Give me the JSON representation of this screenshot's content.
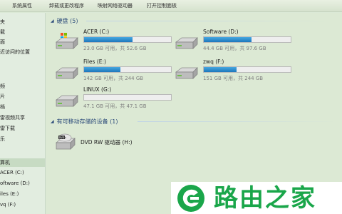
{
  "toolbar": {
    "items": [
      "系统属性",
      "卸载或更改程序",
      "映射网络驱动器",
      "打开控制面板"
    ]
  },
  "sidebar": {
    "items": [
      {
        "label": "夹"
      },
      {
        "label": "载"
      },
      {
        "label": "面"
      },
      {
        "label": "近访问的位置"
      },
      {
        "label": "频"
      },
      {
        "label": "片"
      },
      {
        "label": "档"
      },
      {
        "label": "雷视频共享"
      },
      {
        "label": "雷下载"
      },
      {
        "label": "乐"
      },
      {
        "label": "算机"
      },
      {
        "label": "ACER (C:)"
      },
      {
        "label": "oftware (D:)"
      },
      {
        "label": "iles (E:)"
      },
      {
        "label": "vq (F:)"
      }
    ],
    "selected_index": 10
  },
  "hard_disks": {
    "header": "硬盘 (5)",
    "drives": [
      {
        "name": "ACER (C:)",
        "space": "23.0 GB 可用，共 52.6 GB",
        "used_fraction": 0.56,
        "icon": "windows-drive-icon"
      },
      {
        "name": "Software (D:)",
        "space": "44.4 GB 可用，共 97.6 GB",
        "used_fraction": 0.55,
        "icon": "hard-drive-icon"
      },
      {
        "name": "Files (E:)",
        "space": "142 GB 可用，共 244 GB",
        "used_fraction": 0.42,
        "icon": "hard-drive-icon"
      },
      {
        "name": "zwq (F:)",
        "space": "151 GB 可用，共 244 GB",
        "used_fraction": 0.38,
        "icon": "hard-drive-icon"
      },
      {
        "name": "LINUX (G:)",
        "space": "47.1 GB 可用，共 47.1 GB",
        "used_fraction": 0.0,
        "icon": "hard-drive-icon"
      }
    ]
  },
  "removable": {
    "header": "有可移动存储的设备 (1)",
    "devices": [
      {
        "name": "DVD RW 驱动器 (H:)",
        "icon": "dvd-drive-icon"
      }
    ]
  },
  "watermark": {
    "text": "路由之家"
  },
  "colors": {
    "bar_fill": "#1d77bc",
    "watermark_green": "#1aa64a",
    "header_blue": "#2c4b7a"
  }
}
